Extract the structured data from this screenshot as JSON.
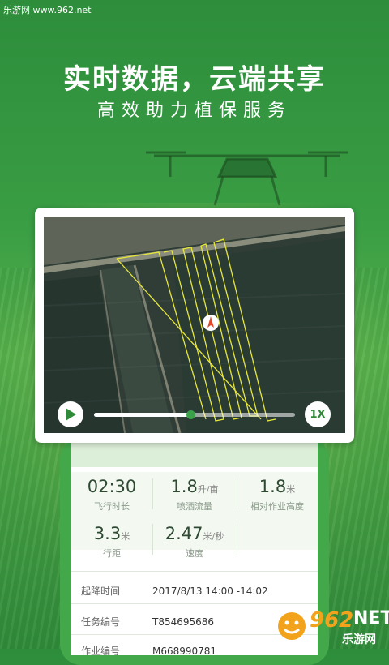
{
  "watermark": {
    "text": "乐游网 www.962.net"
  },
  "promo": {
    "headline": "实时数据，云端共享",
    "subline": "高效助力植保服务"
  },
  "playback": {
    "speed_label": "1X",
    "progress": 0.48,
    "icon_play": "play-icon"
  },
  "stats": [
    {
      "value": "02:30",
      "unit": "",
      "label": "飞行时长"
    },
    {
      "value": "1.8",
      "unit": "升/亩",
      "label": "喷洒流量"
    },
    {
      "value": "1.8",
      "unit": "米",
      "label": "相对作业高度"
    },
    {
      "value": "3.3",
      "unit": "米",
      "label": "行距"
    },
    {
      "value": "2.47",
      "unit": "米/秒",
      "label": "速度"
    }
  ],
  "details": [
    {
      "key": "起降时间",
      "value": "2017/8/13  14:00 -14:02"
    },
    {
      "key": "任务编号",
      "value": "T854695686"
    },
    {
      "key": "作业编号",
      "value": "M668990781"
    }
  ],
  "logo": {
    "num": "962",
    "net": "NET",
    "cn": "乐游网"
  },
  "colors": {
    "brand_green": "#3aa34a",
    "track_yellow": "#e8e83a",
    "logo_orange": "#f2a31b"
  }
}
